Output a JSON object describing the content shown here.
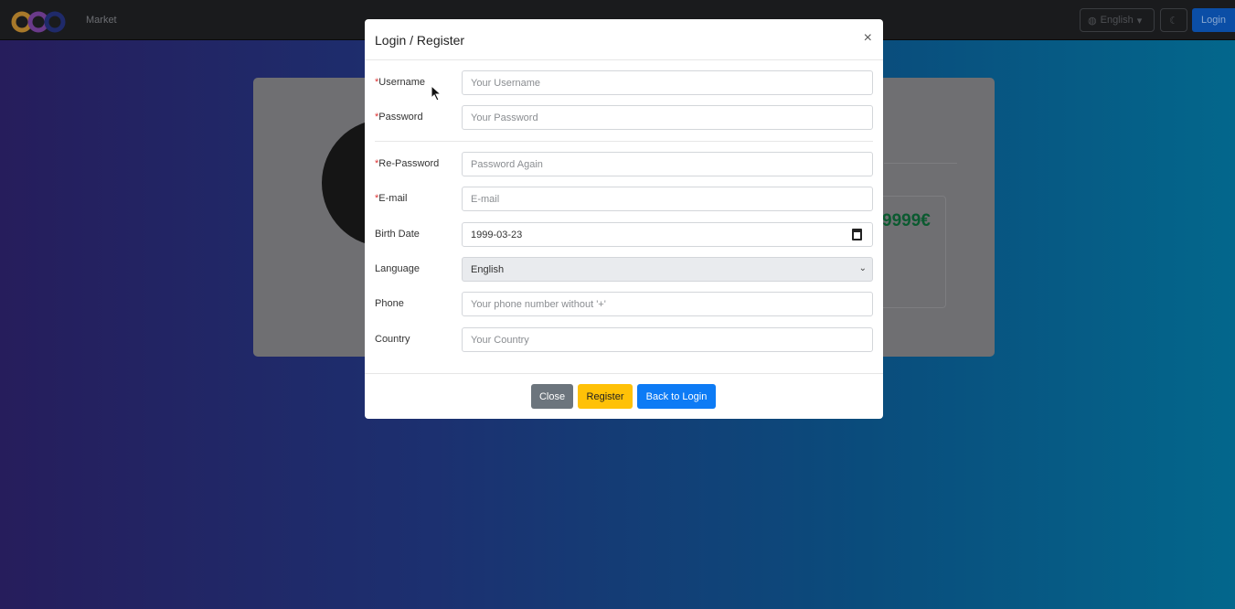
{
  "nav": {
    "brand": "Market",
    "language": "English",
    "login": "Login"
  },
  "background_card": {
    "price": "9999€"
  },
  "modal": {
    "title": "Login / Register",
    "close_icon": "×",
    "fields": [
      {
        "label": "Username",
        "required": true,
        "placeholder": "Your Username",
        "value": ""
      },
      {
        "label": "Password",
        "required": true,
        "placeholder": "Your Password",
        "value": ""
      },
      {
        "label": "Re-Password",
        "required": true,
        "placeholder": "Password Again",
        "value": ""
      },
      {
        "label": "E-mail",
        "required": true,
        "placeholder": "E-mail",
        "value": ""
      },
      {
        "label": "Birth Date",
        "required": false,
        "value": "1999-03-23"
      },
      {
        "label": "Language",
        "required": false,
        "value": "English"
      },
      {
        "label": "Phone",
        "required": false,
        "placeholder": "Your phone number without '+'",
        "value": ""
      },
      {
        "label": "Country",
        "required": false,
        "placeholder": "Your Country",
        "value": ""
      }
    ],
    "buttons": {
      "close": "Close",
      "register": "Register",
      "back": "Back to Login"
    }
  },
  "colors": {
    "primary": "#0d7bf5",
    "warning": "#ffc107",
    "secondary": "#6c757d"
  }
}
